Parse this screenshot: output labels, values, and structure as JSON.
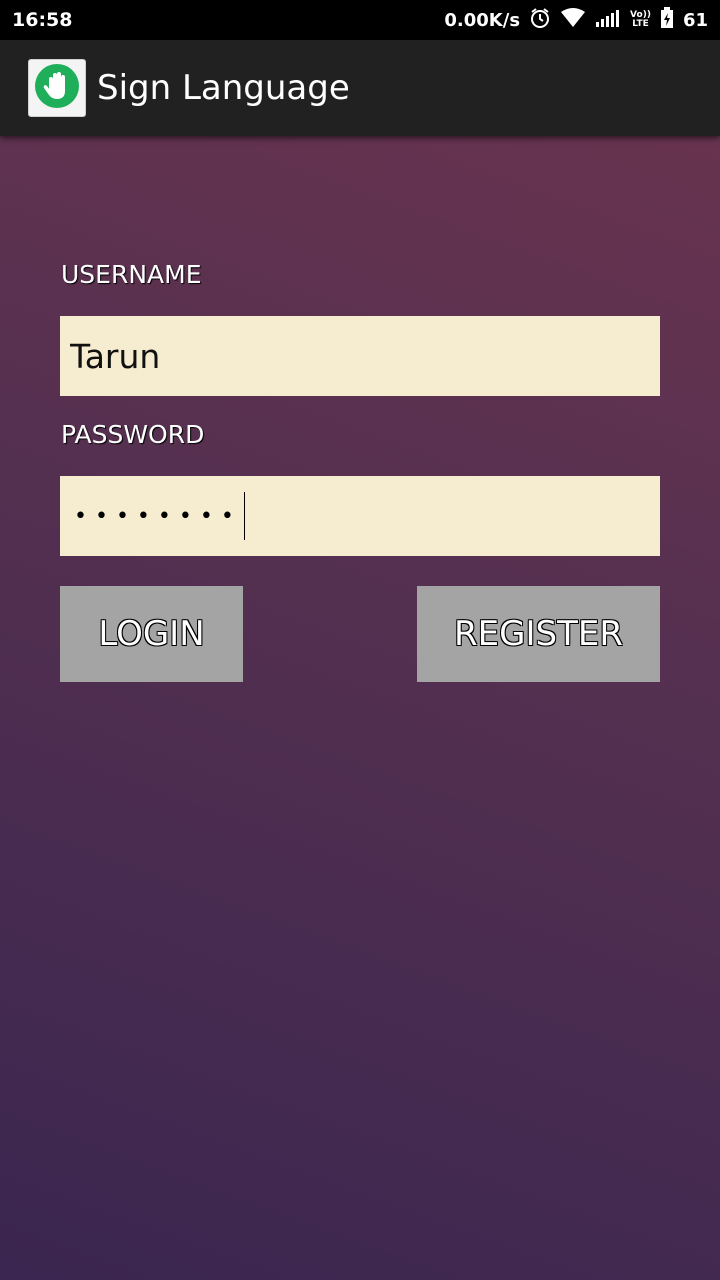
{
  "status_bar": {
    "time": "16:58",
    "net_speed": "0.00K/s",
    "volte_top": "Vo))",
    "volte_bottom": "LTE",
    "battery": "61"
  },
  "toolbar": {
    "title": "Sign Language",
    "icon": "hand-icon"
  },
  "form": {
    "username_label": "USERNAME",
    "username_value": "Tarun",
    "password_label": "PASSWORD",
    "password_mask": "••••••••"
  },
  "buttons": {
    "login": "LOGIN",
    "register": "REGISTER"
  },
  "colors": {
    "field_bg": "#f6eccf",
    "button_bg": "#a4a4a4",
    "toolbar_bg": "#212121",
    "gradient_top": "#6c344f",
    "gradient_bottom": "#3a2650",
    "icon_green": "#1fae5a"
  }
}
